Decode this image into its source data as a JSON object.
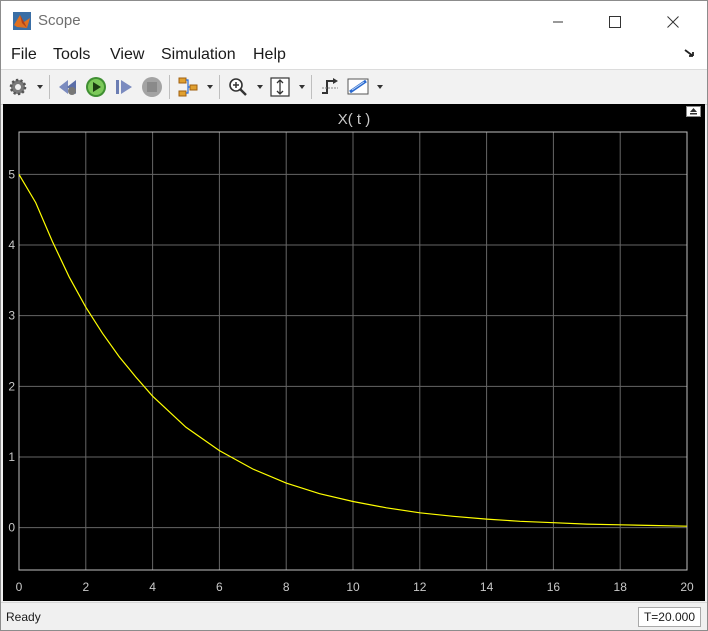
{
  "window": {
    "title": "Scope",
    "icon": "matlab-icon",
    "buttons": [
      "minimize-icon",
      "maximize-icon",
      "close-icon"
    ]
  },
  "menu": {
    "items": [
      "File",
      "Tools",
      "View",
      "Simulation",
      "Help"
    ],
    "overflow_icon": "arrow-icon"
  },
  "toolbar": {
    "icons": [
      "settings-icon",
      "step-back-icon",
      "run-icon",
      "step-forward-icon",
      "stop-icon",
      "highlight-signal-icon",
      "zoom-icon",
      "scale-axes-icon",
      "triggers-icon",
      "cursor-measurements-icon"
    ]
  },
  "plot": {
    "title": "X( t )",
    "undock_icon": "undock-icon"
  },
  "chart_data": {
    "type": "line",
    "title": "X( t )",
    "xlabel": "",
    "ylabel": "",
    "xlim": [
      0,
      20
    ],
    "ylim": [
      -0.6,
      5.6
    ],
    "xticks": [
      "0",
      "2",
      "4",
      "6",
      "8",
      "10",
      "12",
      "14",
      "16",
      "18",
      "20"
    ],
    "yticks": [
      "0",
      "1",
      "2",
      "3",
      "4",
      "5"
    ],
    "grid": true,
    "legend": "none",
    "colors": {
      "background": "#000000",
      "axes_frame": "#c0c0c0",
      "grid": "#666666",
      "line": "#ffff00",
      "tick_label": "#c9c9c9"
    },
    "series": [
      {
        "x": [
          0,
          0.5,
          1,
          1.5,
          2,
          2.5,
          3,
          3.5,
          4,
          5,
          6,
          7,
          8,
          9,
          10,
          11,
          12,
          13,
          14,
          15,
          16,
          17,
          18,
          19,
          20
        ],
        "values": [
          5.0,
          4.6,
          4.05,
          3.55,
          3.12,
          2.75,
          2.42,
          2.13,
          1.86,
          1.42,
          1.09,
          0.83,
          0.63,
          0.48,
          0.37,
          0.28,
          0.21,
          0.16,
          0.12,
          0.09,
          0.07,
          0.05,
          0.04,
          0.03,
          0.02
        ]
      }
    ]
  },
  "status": {
    "left": "Ready",
    "right": "T=20.000"
  }
}
